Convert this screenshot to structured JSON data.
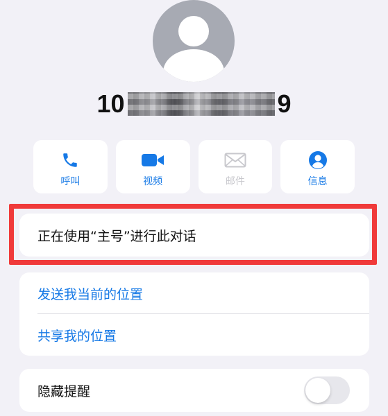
{
  "contact": {
    "phone_prefix": "10",
    "phone_suffix": "9",
    "avatar_icon": "person-silhouette-icon"
  },
  "actions": [
    {
      "label": "呼叫",
      "icon": "phone-icon",
      "enabled": true
    },
    {
      "label": "视频",
      "icon": "video-camera-icon",
      "enabled": true
    },
    {
      "label": "邮件",
      "icon": "envelope-icon",
      "enabled": false
    },
    {
      "label": "信息",
      "icon": "person-circle-icon",
      "enabled": true
    }
  ],
  "status": {
    "text": "正在使用“主号”进行此对话"
  },
  "location": {
    "send_current": "发送我当前的位置",
    "share": "共享我的位置"
  },
  "alerts": {
    "label": "隐藏提醒",
    "toggle_on": false
  },
  "colors": {
    "accent": "#1679e6",
    "disabled": "#c8c8cd",
    "highlight": "#f03a3a",
    "background": "#f2f1f7"
  }
}
